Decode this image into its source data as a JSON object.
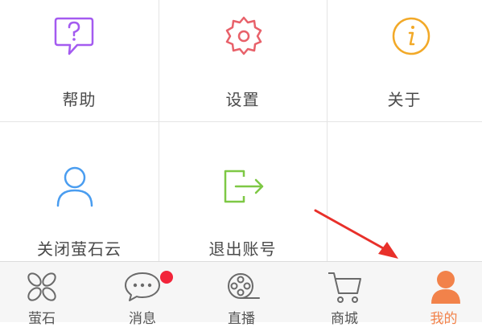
{
  "menu": {
    "items": [
      {
        "label": "帮助",
        "icon": "help-chat-icon",
        "color": "#a45bf0"
      },
      {
        "label": "设置",
        "icon": "gear-icon",
        "color": "#e8616a"
      },
      {
        "label": "关于",
        "icon": "info-icon",
        "color": "#f2a928"
      },
      {
        "label": "关闭萤石云",
        "icon": "user-icon",
        "color": "#4a9df0"
      },
      {
        "label": "退出账号",
        "icon": "logout-icon",
        "color": "#7ec845"
      }
    ]
  },
  "tabbar": {
    "tabs": [
      {
        "label": "萤石",
        "icon": "ezviz-logo-icon",
        "active": false
      },
      {
        "label": "消息",
        "icon": "message-bubble-icon",
        "active": false,
        "badge": true
      },
      {
        "label": "直播",
        "icon": "film-reel-icon",
        "active": false
      },
      {
        "label": "商城",
        "icon": "shopping-cart-icon",
        "active": false
      },
      {
        "label": "我的",
        "icon": "person-icon",
        "active": true
      }
    ],
    "active_color": "#f2824a",
    "badge_color": "#f2243a"
  },
  "annotation": {
    "type": "red-arrow",
    "color": "#e8302a"
  }
}
